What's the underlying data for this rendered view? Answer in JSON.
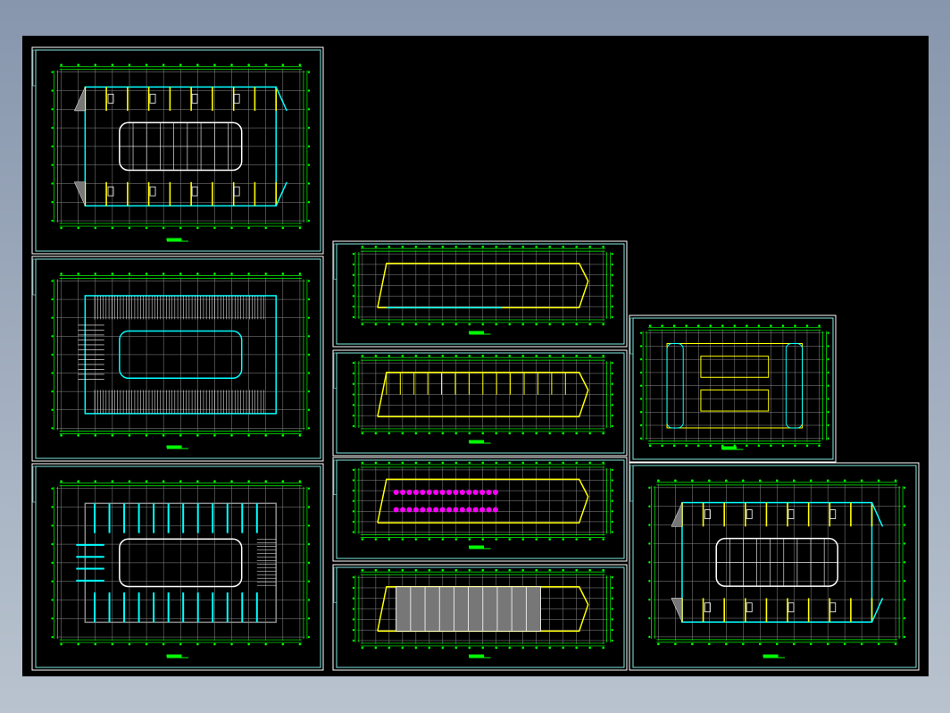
{
  "viewport": {
    "background": "#000000",
    "colors": {
      "frame": "#ffffff",
      "inner_frame": "#7fe8e0",
      "dimension": "#00ff00",
      "grid": "#8c8c8c",
      "wall": "#00ffff",
      "column": "#ffff00",
      "furniture": "#ff00ff",
      "stair": "#ffffff"
    }
  },
  "sheets": [
    {
      "id": "plan-ground",
      "kind": "plan-courtyard"
    },
    {
      "id": "plan-stands",
      "kind": "plan-seating"
    },
    {
      "id": "plan-roof-structure",
      "kind": "plan-beams"
    },
    {
      "id": "section-a",
      "kind": "long-outline"
    },
    {
      "id": "section-b",
      "kind": "long-rooms"
    },
    {
      "id": "section-c",
      "kind": "long-furniture"
    },
    {
      "id": "section-d",
      "kind": "long-seating"
    },
    {
      "id": "plan-small",
      "kind": "small-plan"
    },
    {
      "id": "plan-upper",
      "kind": "plan-courtyard"
    }
  ]
}
